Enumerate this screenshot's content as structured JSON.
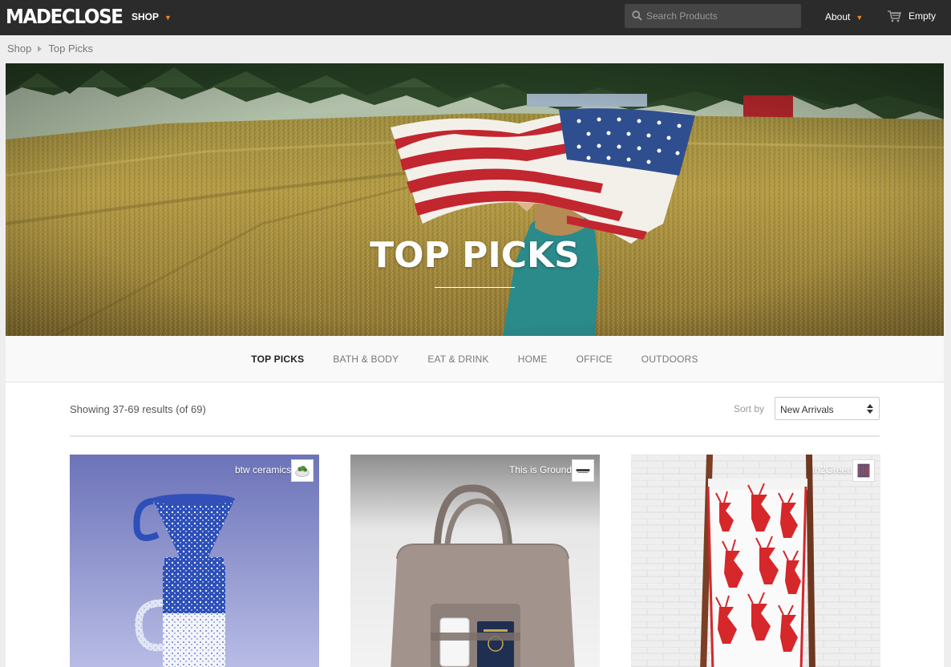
{
  "header": {
    "logo": "MADECLOSE",
    "shop_label": "SHOP",
    "search_placeholder": "Search Products",
    "about_label": "About",
    "cart_label": "Empty",
    "accent_color": "#e8892b"
  },
  "breadcrumb": [
    "Shop",
    "Top Picks"
  ],
  "hero": {
    "title": "TOP PICKS"
  },
  "categories": [
    {
      "label": "TOP PICKS",
      "active": true
    },
    {
      "label": "BATH & BODY",
      "active": false
    },
    {
      "label": "EAT & DRINK",
      "active": false
    },
    {
      "label": "HOME",
      "active": false
    },
    {
      "label": "OFFICE",
      "active": false
    },
    {
      "label": "OUTDOORS",
      "active": false
    }
  ],
  "listing": {
    "results_text": "Showing 37-69 results (of 69)",
    "sort_label": "Sort by",
    "sort_value": "New Arrivals"
  },
  "products": [
    {
      "brand": "btw ceramics"
    },
    {
      "brand": "This is Ground"
    },
    {
      "brand": "In2Green"
    }
  ]
}
